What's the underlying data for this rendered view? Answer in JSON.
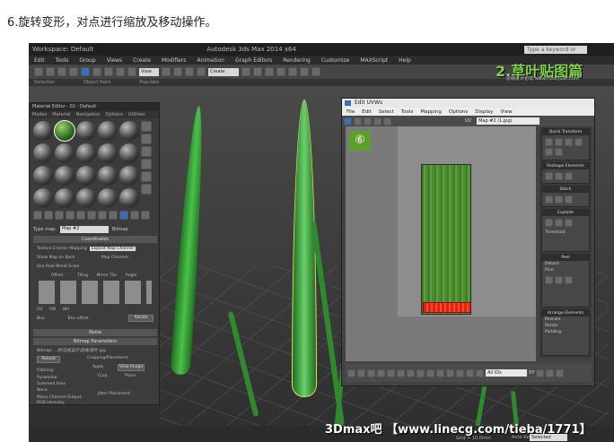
{
  "caption": "6.旋转变形，对点进行缩放及移动操作。",
  "window": {
    "title": "Workspace: Default",
    "app_title": "Autodesk 3ds Max 2014 x64",
    "search_placeholder": "Type a keyword or phrase"
  },
  "menubar": [
    "Edit",
    "Tools",
    "Group",
    "Views",
    "Create",
    "Modifiers",
    "Animation",
    "Graph Editors",
    "Rendering",
    "Customize",
    "MAXScript",
    "Help"
  ],
  "ribbon": [
    "Selection",
    "Object Paint",
    "Populate"
  ],
  "toolbar": {
    "view_label": "View",
    "create_selection": "Create Selection"
  },
  "overlay": {
    "title": "2.草叶贴图篇",
    "sub": "思缘设计论坛 www.missyuan.com"
  },
  "material_editor": {
    "title": "Material Editor - 02 - Default",
    "menu": [
      "Modes",
      "Material",
      "Navigation",
      "Options",
      "Utilities"
    ],
    "map_label": "Type map:",
    "map_name": "Map #2",
    "bitmap_label": "Bitmap",
    "coordinates": "Coordinates",
    "texture": "Texture",
    "environ": "Environ",
    "mapping_label": "Mapping:",
    "mapping_value": "Explicit Map Channel",
    "show_map": "Show Map on Back",
    "map_channel": "Map Channel:",
    "real_world": "Use Real-World Scale",
    "offset": "Offset",
    "tiling": "Tiling",
    "mirror_tile": "Mirror Tile",
    "angle": "Angle",
    "uv_opts": [
      "UV",
      "VW",
      "WU"
    ],
    "blur": "Blur",
    "blur_offset": "Blur offset",
    "rotate": "Rotate",
    "noise": "Noise",
    "bitmap_params": "Bitmap Parameters",
    "bitmap_path": "Bitmap: ...材\\信视设计\\思缘\\草叶.jpg",
    "reload": "Reload",
    "cropping": "Cropping/Placement",
    "apply": "Apply",
    "view_image": "View Image",
    "crop": "Crop",
    "place": "Place",
    "filtering": "Filtering",
    "filter_opts": [
      "Pyramidal",
      "Summed Area",
      "None"
    ],
    "mono_output": "Mono Channel Output:",
    "rgb_intensity": "RGB Intensity",
    "jitter": "Jitter Placement:"
  },
  "uvw": {
    "title": "Edit UVWs",
    "menu": [
      "File",
      "Edit",
      "Select",
      "Tools",
      "Mapping",
      "Options",
      "Display",
      "View"
    ],
    "uv_label": "UV",
    "map_select": "Map #2 (1.jpg)",
    "badge": "⑥",
    "panels": {
      "quick_transform": "Quick Transform",
      "reshape": "Reshape Elements",
      "stitch": "Stitch",
      "explode": "Explode",
      "threshold": "Threshold:",
      "peel": "Peel",
      "detach": "Detach",
      "pins": "Pins:",
      "arrange": "Arrange Elements",
      "rescale": "Rescale",
      "rotate": "Rotate",
      "padding": "Padding:"
    },
    "all_ids": "All IDs",
    "xy_label": "XY"
  },
  "status": {
    "watermark": "3Dmax吧 【www.linecg.com/tieba/1771】",
    "grid": "Grid = 10.0mm",
    "autokey": "Auto Key",
    "selected": "Selected"
  },
  "colors": {
    "accent_green": "#7fd04a",
    "uv_selection": "#e02020",
    "badge_green": "#5aa02a"
  }
}
